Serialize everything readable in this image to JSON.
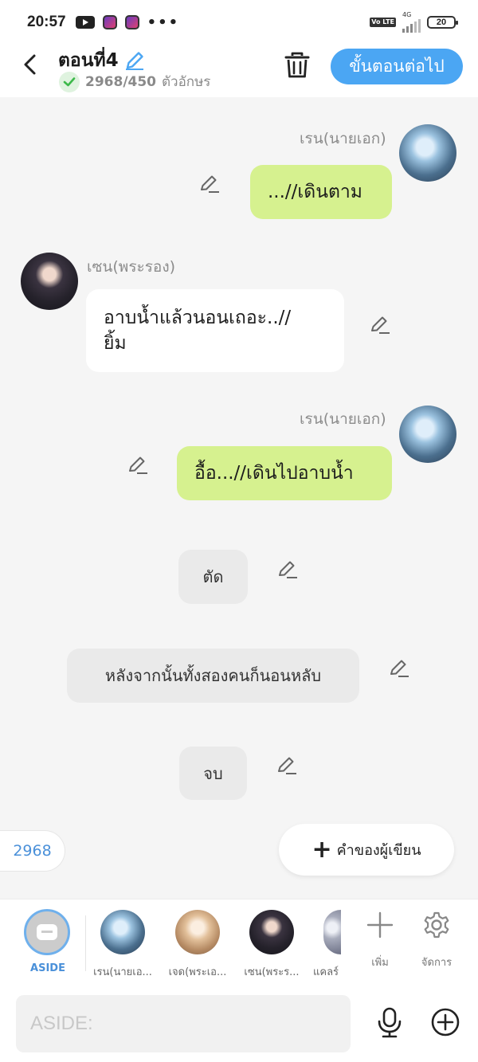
{
  "status_bar": {
    "time": "20:57",
    "network": "4G",
    "volte": "Vo LTE",
    "battery": "20"
  },
  "header": {
    "title": "ตอนที่4",
    "char_count": "2968/450",
    "char_unit": "ตัวอักษร",
    "next_button": "ขั้นตอนต่อไป"
  },
  "messages": {
    "m1": {
      "speaker": "เรน(นายเอก)",
      "text": "...//เดินตาม"
    },
    "m2": {
      "speaker": "เซน(พระรอง)",
      "line1": "อาบน้ำแล้วนอนเถอะ..//",
      "line2": "ยิ้ม"
    },
    "m3": {
      "speaker": "เรน(นายเอก)",
      "text": "อื้อ...//เดินไปอาบน้ำ"
    },
    "n1": {
      "text": "ตัด"
    },
    "n2": {
      "text": "หลังจากนั้นทั้งสองคนก็นอนหลับ"
    },
    "n3": {
      "text": "จบ"
    }
  },
  "counter": "2968",
  "author_note_button": "คำของผู้เขียน",
  "character_bar": {
    "aside_label": "ASIDE",
    "characters": [
      {
        "label": "เรน(นายเอ..."
      },
      {
        "label": "เจด(พระเอ..."
      },
      {
        "label": "เซน(พระร..."
      },
      {
        "label": "แคลร์"
      }
    ],
    "add_label": "เพิ่ม",
    "manage_label": "จัดการ"
  },
  "input": {
    "placeholder": "ASIDE:"
  },
  "colors": {
    "accent": "#4ba6f3",
    "green_bubble": "#d6f18f",
    "background": "#f5f5f5"
  }
}
